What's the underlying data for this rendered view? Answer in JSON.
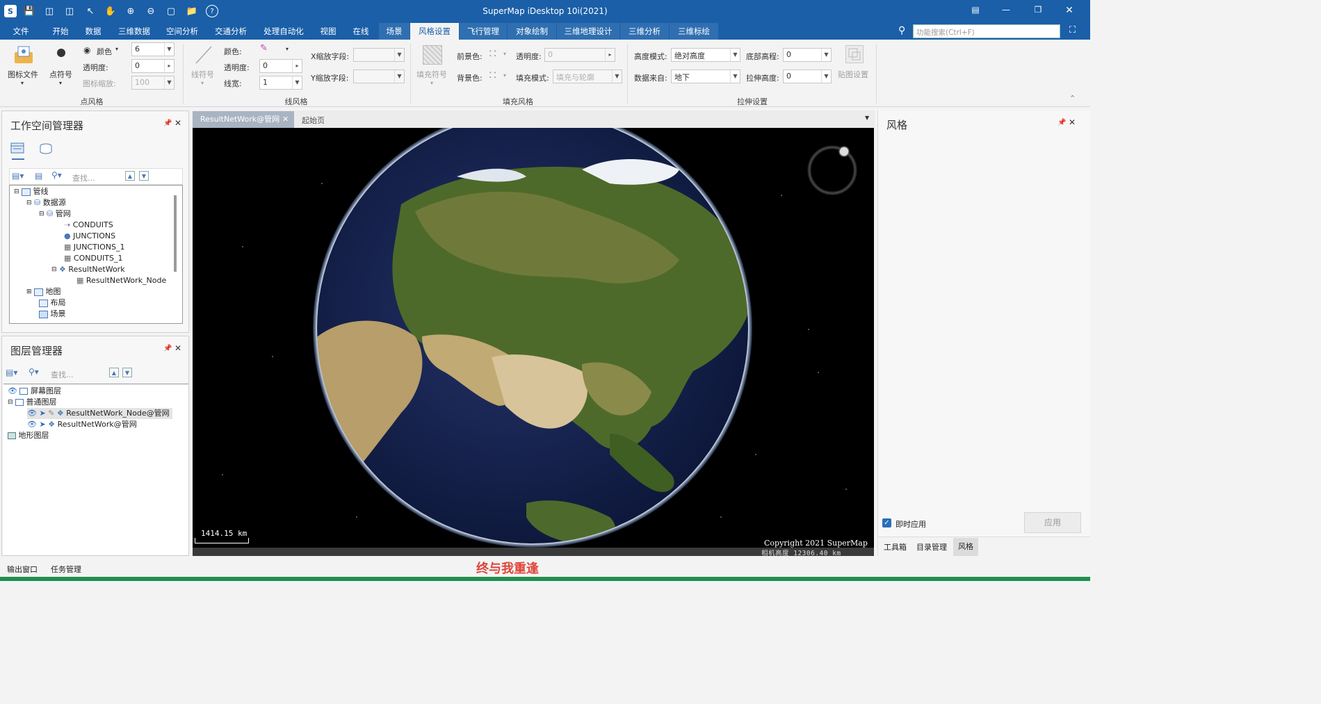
{
  "window": {
    "title": "SuperMap iDesktop 10i(2021)"
  },
  "menu": {
    "tabs": [
      "文件",
      "开始",
      "数据",
      "三维数据",
      "空间分析",
      "交通分析",
      "处理自动化",
      "视图",
      "在线",
      "场景",
      "风格设置",
      "飞行管理",
      "对象绘制",
      "三维地理设计",
      "三维分析",
      "三维标绘"
    ],
    "selected": "风格设置",
    "search_placeholder": "功能搜索(Ctrl+F)"
  },
  "ribbon": {
    "point_style": {
      "group_label": "点风格",
      "icon_file_label": "图标文件",
      "point_symbol_label": "点符号",
      "color_label": "颜色",
      "transparency_label": "透明度:",
      "icon_scale_label": "图标缩放:",
      "size_value": "6",
      "transparency_value": "0",
      "icon_scale_value": "100"
    },
    "line_style": {
      "group_label": "线风格",
      "line_symbol_label": "线符号",
      "color_label": "颜色:",
      "transparency_label": "透明度:",
      "line_width_label": "线宽:",
      "transparency_value": "0",
      "line_width_value": "1",
      "x_scale_label": "X缩放字段:",
      "y_scale_label": "Y缩放字段:"
    },
    "fill_style": {
      "group_label": "填充风格",
      "fill_symbol_label": "填充符号",
      "foreground_label": "前景色:",
      "background_label": "背景色:",
      "transparency_label": "透明度:",
      "transparency_value": "0",
      "fill_mode_label": "填充模式:",
      "fill_mode_value": "填充与轮廓"
    },
    "extrude": {
      "group_label": "拉伸设置",
      "height_mode_label": "高度模式:",
      "height_mode_value": "绝对高度",
      "data_source_label": "数据来自:",
      "data_source_value": "地下",
      "bottom_height_label": "底部高程:",
      "bottom_height_value": "0",
      "extrude_height_label": "拉伸高度:",
      "extrude_height_value": "0",
      "texture_label": "贴图设置"
    }
  },
  "workspace": {
    "title": "工作空间管理器",
    "search_placeholder": "查找...",
    "tree": {
      "root": "管线",
      "datasources": "数据源",
      "db": "管网",
      "datasets": [
        "CONDUITS",
        "JUNCTIONS",
        "JUNCTIONS_1",
        "CONDUITS_1",
        "ResultNetWork"
      ],
      "sub_dataset": "ResultNetWork_Node",
      "maps": "地图",
      "layouts": "布局",
      "scenes": "场景"
    }
  },
  "layers": {
    "title": "图层管理器",
    "search_placeholder": "查找...",
    "screen_layer": "屏幕图层",
    "normal_layer": "普通图层",
    "layer1": "ResultNetWork_Node@管网",
    "layer2": "ResultNetWork@管网",
    "terrain_layer": "地形图层"
  },
  "doc_tabs": {
    "active": "ResultNetWork@管网",
    "start": "起始页"
  },
  "map": {
    "scale_text": "1414.15 km",
    "copyright": "Copyright 2021 SuperMap",
    "camera_height": "相机高度 12306.40 km"
  },
  "style_panel": {
    "title": "风格",
    "instant_apply_label": "即时应用",
    "instant_apply_checked": true,
    "apply_label": "应用",
    "bottom_tabs": [
      "工具箱",
      "目录管理",
      "风格"
    ],
    "active_tab": "风格"
  },
  "status": {
    "output_label": "输出窗口",
    "task_label": "任务管理",
    "caption": "终与我重逢"
  },
  "colors": {
    "title_blue": "#1a5fa8",
    "caption_red": "#e0443a",
    "bottom_green": "#1f8f4d"
  }
}
